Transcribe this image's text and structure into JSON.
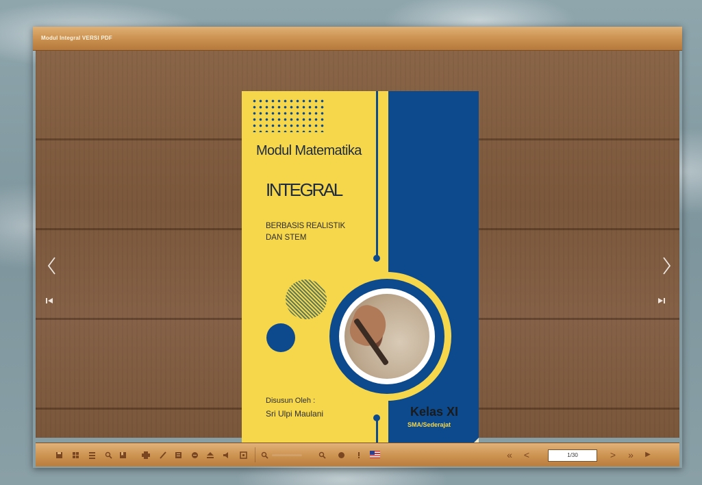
{
  "viewer": {
    "title": "Modul Integral VERSI PDF"
  },
  "navigation": {
    "prev_glyph": "<",
    "next_glyph": ">",
    "first_glyph": "⏮",
    "last_glyph": "⏭"
  },
  "cover": {
    "heading": "Modul Matematika",
    "title": "INTEGRAL",
    "subtitle_line1": "BERBASIS REALISTIK",
    "subtitle_line2": "DAN STEM",
    "author_label": "Disusun Oleh :",
    "author_name": "Sri Ulpi Maulani",
    "class": "Kelas XI",
    "level": "SMA/Sederajat",
    "colors": {
      "yellow": "#f6d74c",
      "blue": "#0c4a8d"
    }
  },
  "toolbar": {
    "icons": [
      "save-icon",
      "thumbnails-icon",
      "table-of-contents-icon",
      "search-icon",
      "bookmark-icon",
      "print-icon",
      "annotate-pen-icon",
      "notes-icon",
      "share-icon",
      "download-icon",
      "sound-icon",
      "fullscreen-icon",
      "zoom-out-icon",
      "zoom-in-icon",
      "auto-flip-icon",
      "help-icon",
      "language-flag-icon"
    ],
    "page_indicator": "1/30",
    "nav_glyphs": {
      "first": "«",
      "prev": "<",
      "next": ">",
      "last_double": "»",
      "play": "▶"
    }
  }
}
